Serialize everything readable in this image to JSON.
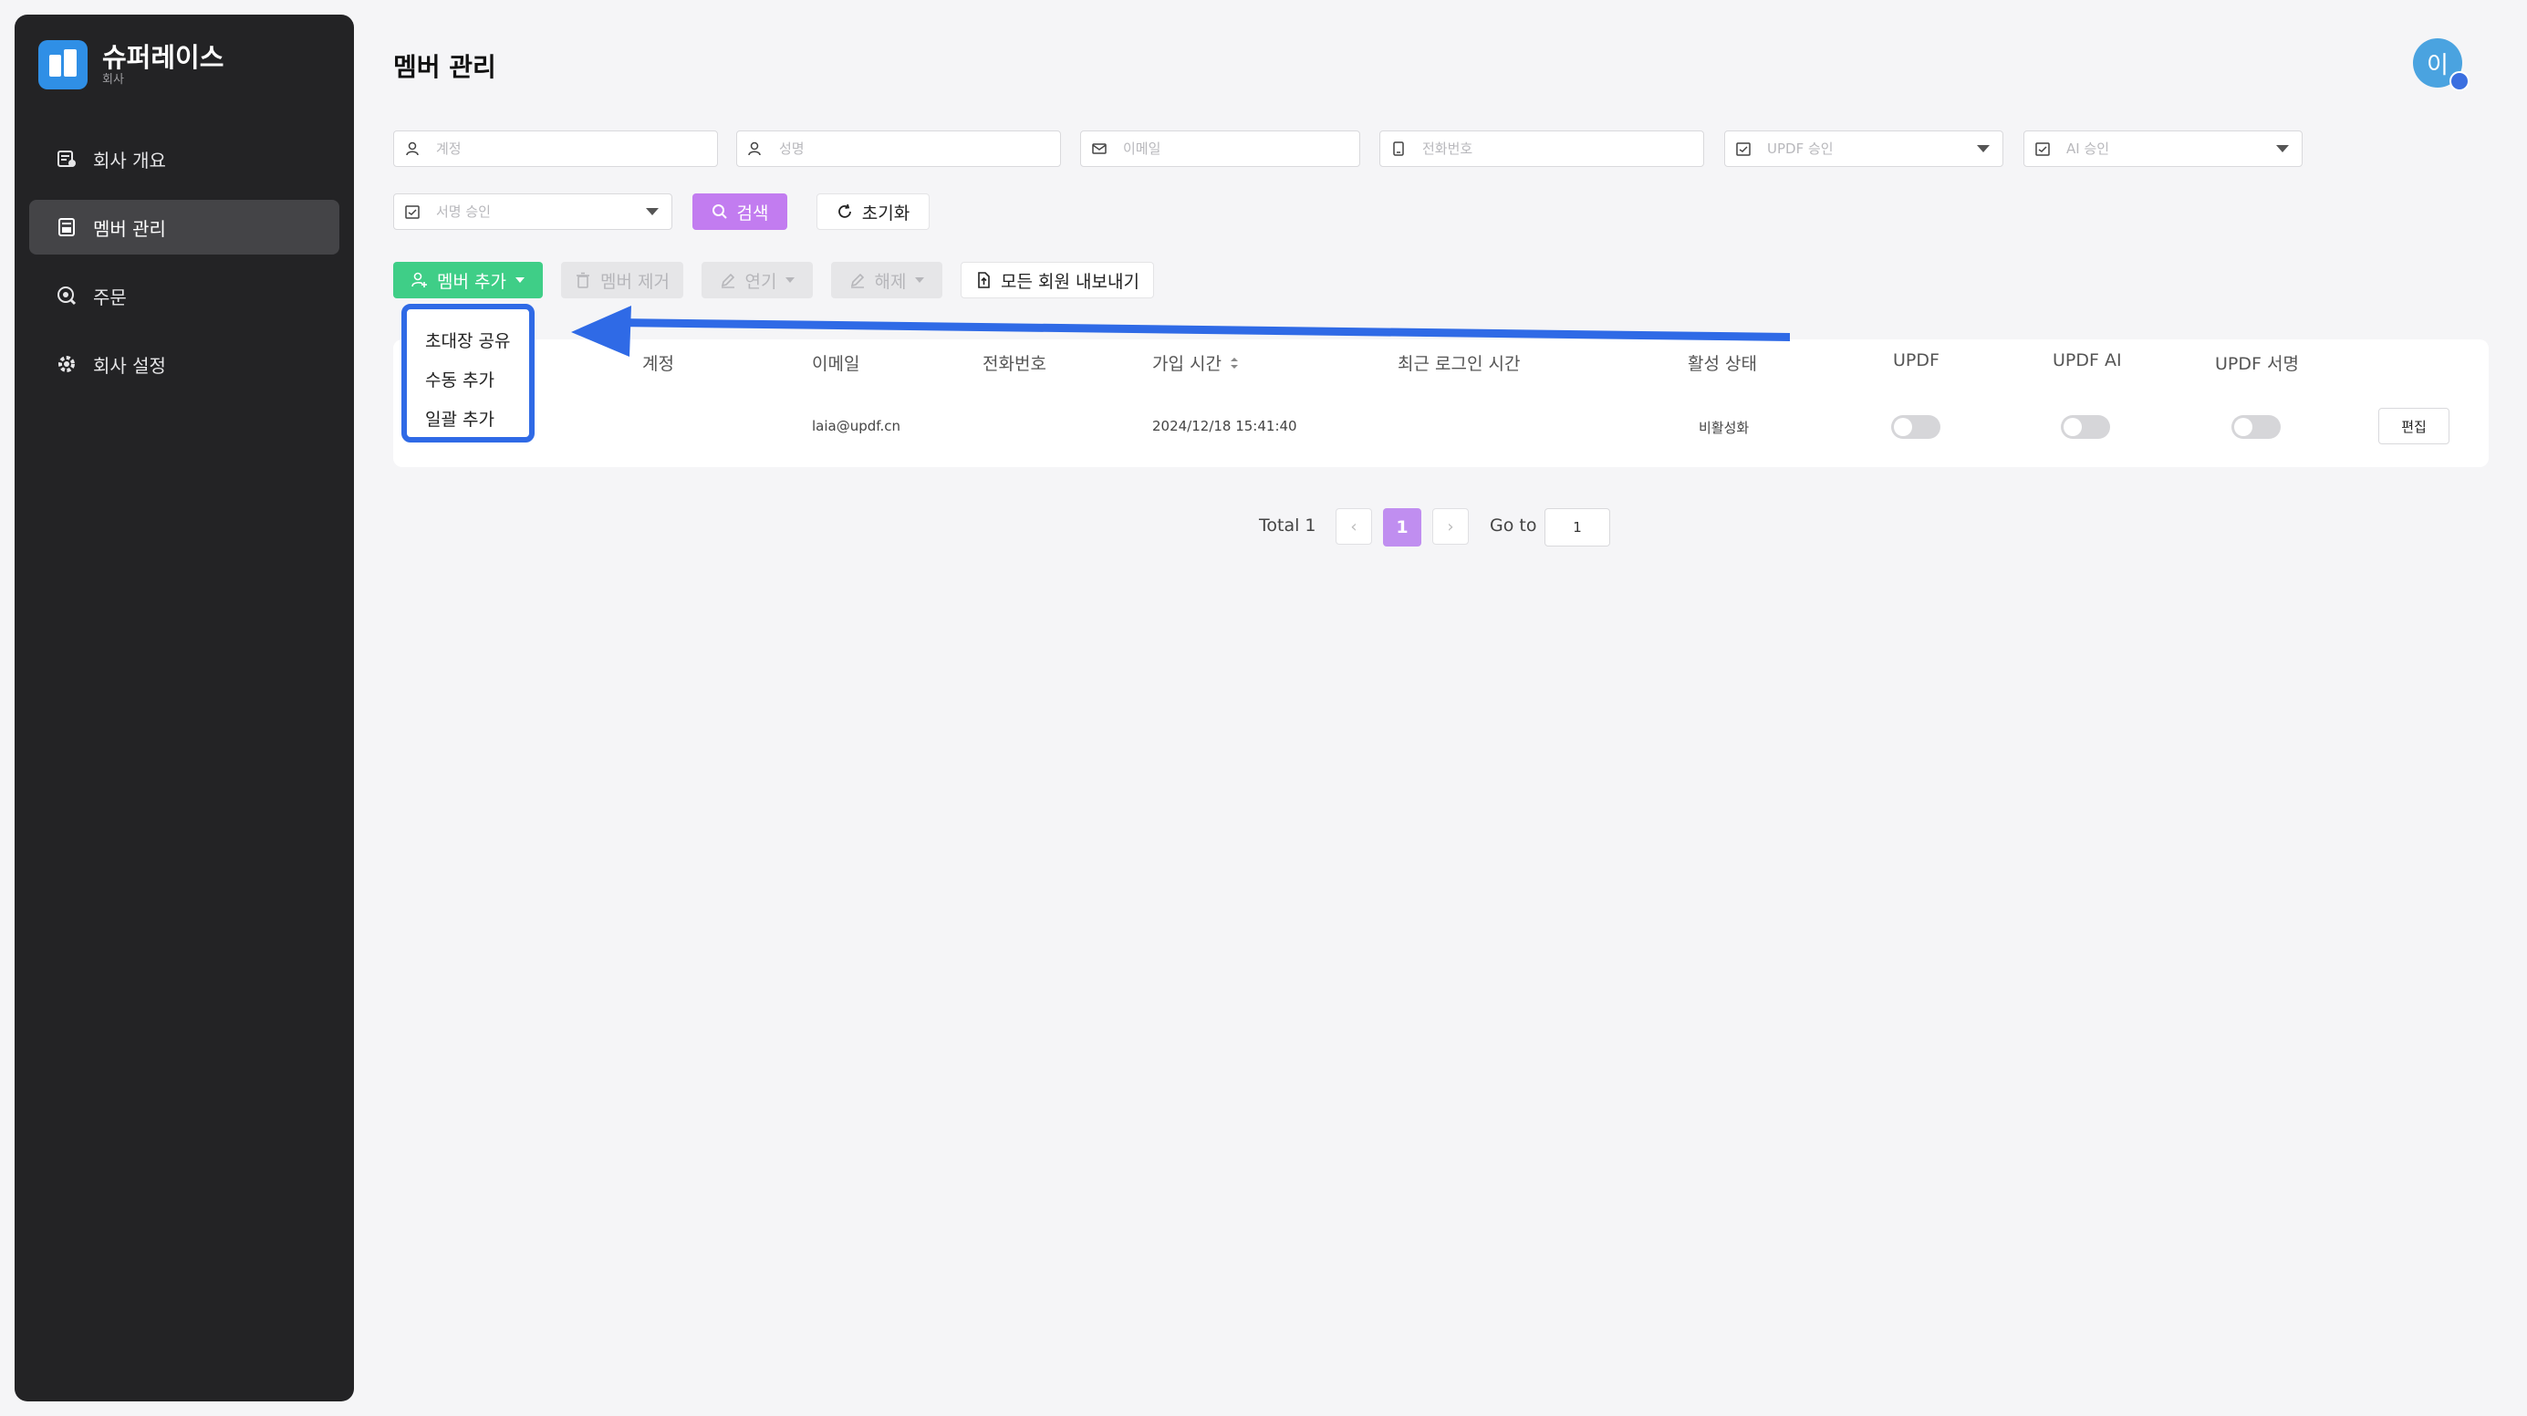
{
  "brand": {
    "name": "슈퍼레이스",
    "subtitle": "회사"
  },
  "sidebar": {
    "items": [
      {
        "label": "회사 개요",
        "icon": "overview-icon",
        "active": false
      },
      {
        "label": "멤버 관리",
        "icon": "members-icon",
        "active": true
      },
      {
        "label": "주문",
        "icon": "orders-icon",
        "active": false
      },
      {
        "label": "회사 설정",
        "icon": "gear-icon",
        "active": false
      }
    ]
  },
  "header": {
    "title": "멤버 관리",
    "avatar_initial": "이"
  },
  "filters": {
    "account": "계정",
    "name": "성명",
    "email": "이메일",
    "phone": "전화번호",
    "updf_approval": "UPDF 승인",
    "ai_approval": "AI 승인",
    "sign_approval": "서명 승인"
  },
  "buttons": {
    "search": "검색",
    "reset": "초기화",
    "add_member": "멤버 추가",
    "remove_member": "멤버 제거",
    "extend": "연기",
    "reset_seat": "해제",
    "export_all": "모든 회원 내보내기"
  },
  "dropdown": {
    "items": [
      "초대장 공유",
      "수동 추가",
      "일괄 추가"
    ]
  },
  "table": {
    "columns": [
      "계정",
      "이메일",
      "전화번호",
      "가입 시간",
      "최근 로그인 시간",
      "활성 상태",
      "UPDF",
      "UPDF AI",
      "UPDF 서명"
    ],
    "rows": [
      {
        "account": "",
        "email": "laia@updf.cn",
        "phone": "",
        "joined": "2024/12/18 15:41:40",
        "last_login": "",
        "status": "비활성화",
        "updf": false,
        "updf_ai": false,
        "updf_sign": false,
        "action": "편집"
      }
    ]
  },
  "pagination": {
    "total_label": "Total 1",
    "current_page": "1",
    "goto_label": "Go to",
    "goto_value": "1"
  },
  "colors": {
    "sidebar": "#232325",
    "add_button": "#3fce87",
    "search_button": "#c27cf0",
    "highlight": "#2f6ae6",
    "page_current": "#c08ef0"
  }
}
